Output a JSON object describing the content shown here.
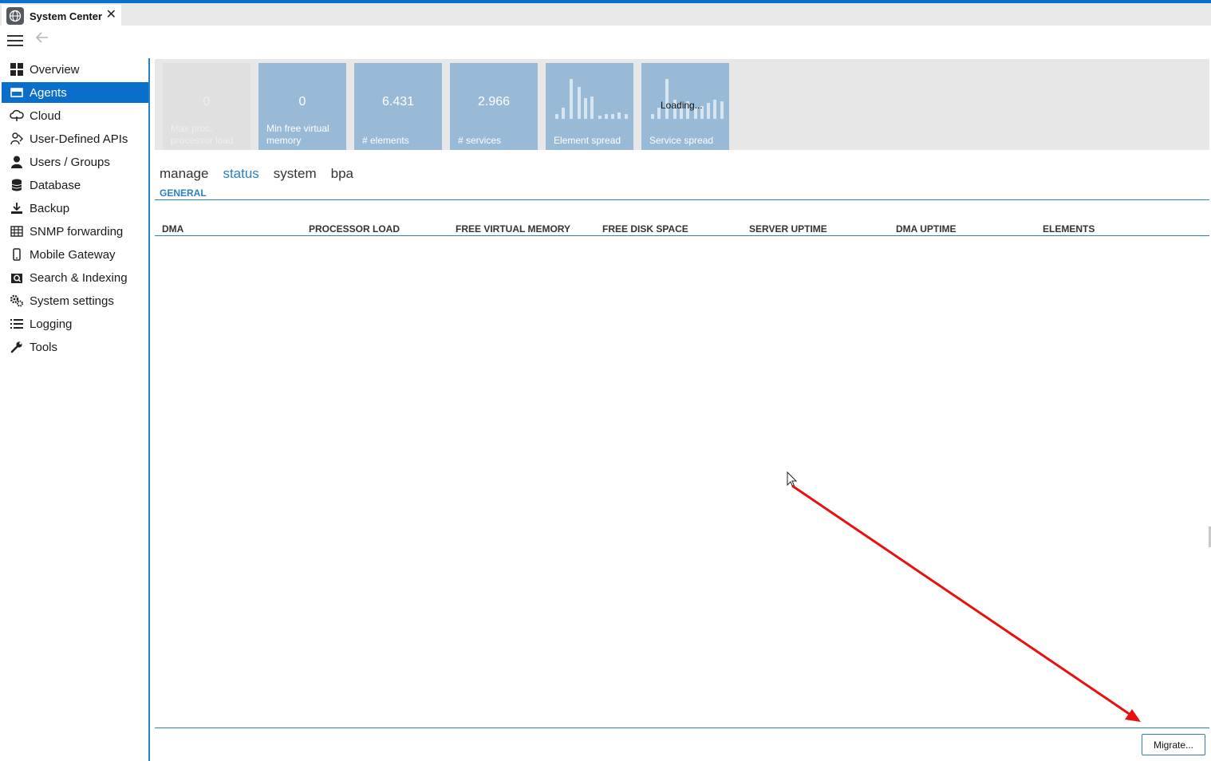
{
  "tab": {
    "title": "System Center",
    "close_symbol": "✕"
  },
  "sidebar": {
    "items": [
      {
        "label": "Overview",
        "icon": "grid-icon"
      },
      {
        "label": "Agents",
        "icon": "server-icon",
        "active": true
      },
      {
        "label": "Cloud",
        "icon": "cloud-icon"
      },
      {
        "label": "User-Defined APIs",
        "icon": "api-icon"
      },
      {
        "label": "Users / Groups",
        "icon": "user-icon"
      },
      {
        "label": "Database",
        "icon": "database-icon"
      },
      {
        "label": "Backup",
        "icon": "download-icon"
      },
      {
        "label": "SNMP forwarding",
        "icon": "snmp-icon"
      },
      {
        "label": "Mobile Gateway",
        "icon": "mobile-icon"
      },
      {
        "label": "Search & Indexing",
        "icon": "search-icon"
      },
      {
        "label": "System settings",
        "icon": "gears-icon"
      },
      {
        "label": "Logging",
        "icon": "list-icon"
      },
      {
        "label": "Tools",
        "icon": "wrench-icon"
      }
    ]
  },
  "tiles": [
    {
      "value": "0",
      "label": "Max proc. processor load",
      "disabled": true
    },
    {
      "value": "0",
      "label": "Min free virtual memory"
    },
    {
      "value": "6.431",
      "label": "# elements"
    },
    {
      "value": "2.966",
      "label": "# services"
    },
    {
      "value": "",
      "label": "Element spread",
      "chart": "element-spread"
    },
    {
      "value": "",
      "label": "Service spread",
      "chart": "service-spread",
      "loading": "Loading..."
    }
  ],
  "subtabs": [
    {
      "label": "manage"
    },
    {
      "label": "status",
      "active": true
    },
    {
      "label": "system"
    },
    {
      "label": "bpa"
    }
  ],
  "section": {
    "label": "GENERAL"
  },
  "table": {
    "columns": [
      "DMA",
      "PROCESSOR LOAD",
      "FREE VIRTUAL MEMORY",
      "FREE DISK SPACE",
      "SERVER UPTIME",
      "DMA UPTIME",
      "ELEMENTS"
    ],
    "rows": []
  },
  "footer": {
    "migrate_label": "Migrate..."
  },
  "colors": {
    "accent": "#0a6ecb",
    "tile": "#98bad7",
    "annotation_arrow": "#e81010"
  }
}
